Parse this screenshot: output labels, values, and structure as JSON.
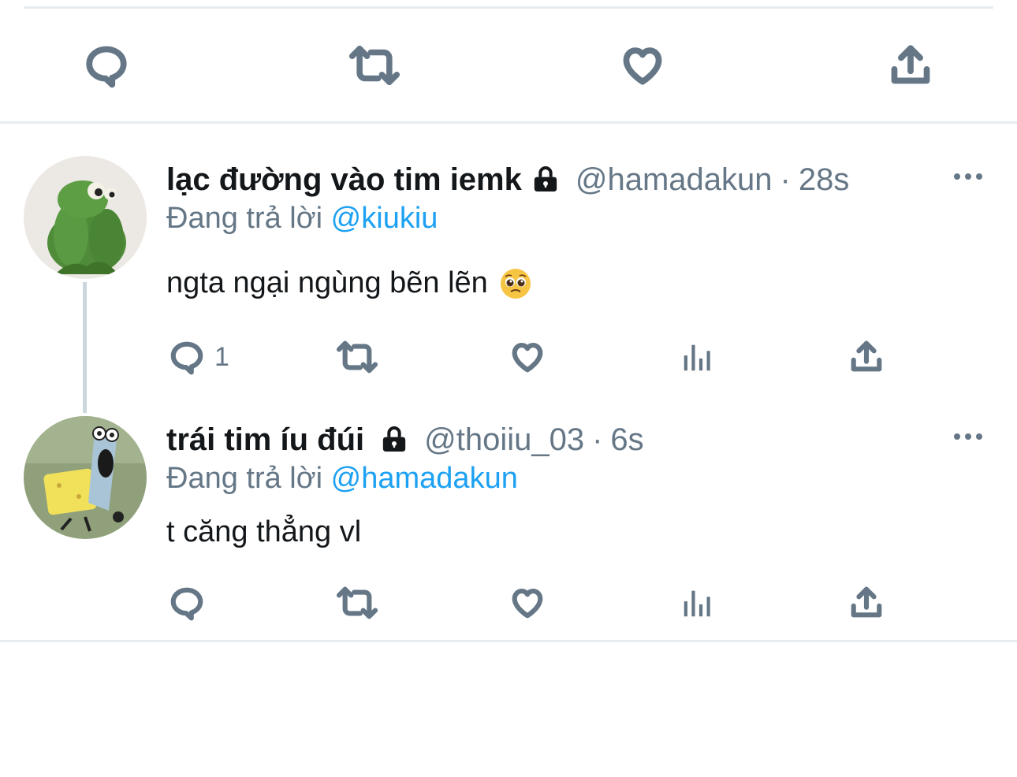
{
  "colors": {
    "accent": "#1da1f2",
    "text": "#14171a",
    "muted": "#657786",
    "divider": "#e6ecf0"
  },
  "top_actions": {
    "icons": [
      "reply-icon",
      "retweet-icon",
      "like-icon",
      "share-icon"
    ]
  },
  "tweets": [
    {
      "display_name": "lạc đường vào tim iemk",
      "protected": true,
      "handle": "@hamadakun",
      "separator": "·",
      "time": "28s",
      "reply_prefix": "Đang trả lời",
      "reply_to": "@kiukiu",
      "text": "ngta ngại ngùng bẽn lẽn",
      "emoji": "pleading-face-emoji",
      "reply_count": "1",
      "avatar": "kermit-avatar"
    },
    {
      "display_name": "trái tim íu đúi",
      "protected": true,
      "handle": "@thoiiu_03",
      "separator": "·",
      "time": "6s",
      "reply_prefix": "Đang trả lời",
      "reply_to": "@hamadakun",
      "text": "t căng thẳng vl",
      "reply_count": "",
      "avatar": "spongebob-avatar"
    }
  ]
}
